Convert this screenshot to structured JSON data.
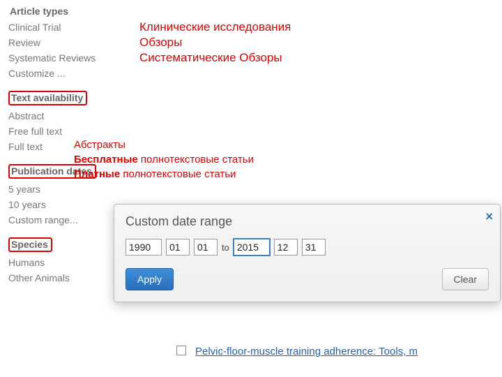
{
  "sidebar": {
    "sections": [
      {
        "header": "Article types",
        "highlighted": false,
        "items": [
          "Clinical Trial",
          "Review",
          "Systematic Reviews",
          "Customize ..."
        ]
      },
      {
        "header": "Text availability",
        "highlighted": true,
        "items": [
          "Abstract",
          "Free full text",
          "Full text"
        ]
      },
      {
        "header": "Publication dates",
        "highlighted": true,
        "items": [
          "5 years",
          "10 years",
          "Custom range..."
        ]
      },
      {
        "header": "Species",
        "highlighted": true,
        "items": [
          "Humans",
          "Other Animals"
        ]
      }
    ]
  },
  "annotations": {
    "block1": [
      "Клинические исследования",
      "Обзоры",
      "Систематические Обзоры"
    ],
    "block2": [
      {
        "bold": "",
        "rest": "Абстракты"
      },
      {
        "bold": "Бесплатные",
        "rest": " полнотекстовые статьи"
      },
      {
        "bold": "Платные",
        "rest": " полнотекстовые статьи"
      }
    ]
  },
  "popup": {
    "title": "Custom date range",
    "to_label": "to",
    "from": {
      "year": "1990",
      "month": "01",
      "day": "01"
    },
    "to": {
      "year": "2015",
      "month": "12",
      "day": "31"
    },
    "apply": "Apply",
    "clear": "Clear"
  },
  "background": {
    "partial_right": "-70",
    "link_text": "Pelvic-floor-muscle training adherence: Tools, m"
  }
}
